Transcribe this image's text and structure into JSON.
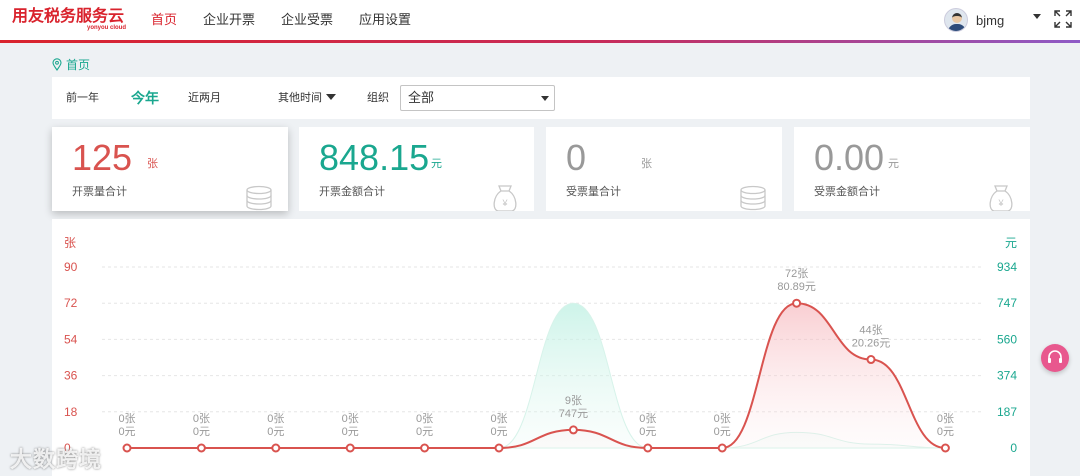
{
  "brand": {
    "name_cn": "用友税务服务云",
    "name_en": "yonyou cloud",
    "color": "#d9232d"
  },
  "nav": {
    "items": [
      "首页",
      "企业开票",
      "企业受票",
      "应用设置"
    ],
    "active_index": 0
  },
  "user": {
    "name": "bjmg",
    "avatar_icon": "user-avatar",
    "caret_icon": "caret-down-icon",
    "fullscreen_icon": "expand-icon"
  },
  "breadcrumb": {
    "icon": "location-pin-icon",
    "label": "首页"
  },
  "filters": {
    "prev_year": "前一年",
    "this_year": "今年",
    "two_months": "近两月",
    "other_time": "其他时间",
    "org_label": "组织",
    "org_value": "全部",
    "active": "今年"
  },
  "stats": [
    {
      "value": "125",
      "unit": "张",
      "label": "开票量合计",
      "icon": "coin-stack-icon",
      "color": "#d9534f"
    },
    {
      "value": "848.15",
      "unit": "元",
      "label": "开票金额合计",
      "icon": "money-bag-icon",
      "color": "#1aa78f"
    },
    {
      "value": "0",
      "unit": "张",
      "label": "受票量合计",
      "icon": "coin-stack-icon",
      "color": "#999999"
    },
    {
      "value": "0.00",
      "unit": "元",
      "label": "受票金额合计",
      "icon": "money-bag-icon",
      "color": "#999999"
    }
  ],
  "chart_data": {
    "type": "line",
    "y_left": {
      "unit": "张",
      "ticks": [
        "0",
        "18",
        "36",
        "54",
        "72",
        "90"
      ],
      "range": [
        0,
        90
      ]
    },
    "y_right": {
      "unit": "元",
      "ticks": [
        "0",
        "187",
        "374",
        "560",
        "747",
        "934"
      ],
      "range": [
        0,
        934
      ]
    },
    "series": [
      {
        "values": [
          0,
          0,
          0,
          0,
          0,
          0,
          9,
          0,
          0,
          72,
          44,
          0
        ],
        "color": "#d9534f"
      },
      {
        "values": [
          0,
          0,
          0,
          0,
          0,
          0,
          747,
          0,
          0,
          80.89,
          20.26,
          0
        ],
        "color": "#1aa78f"
      }
    ],
    "point_labels": [
      [
        "0张",
        "0元"
      ],
      [
        "0张",
        "0元"
      ],
      [
        "0张",
        "0元"
      ],
      [
        "0张",
        "0元"
      ],
      [
        "0张",
        "0元"
      ],
      [
        "0张",
        "0元"
      ],
      [
        "9张",
        "747元"
      ],
      [
        "0张",
        "0元"
      ],
      [
        "0张",
        "0元"
      ],
      [
        "72张",
        "80.89元"
      ],
      [
        "44张",
        "20.26元"
      ],
      [
        "0张",
        "0元"
      ]
    ]
  },
  "support": {
    "icon": "headset-icon"
  },
  "watermark": "大数跨境"
}
